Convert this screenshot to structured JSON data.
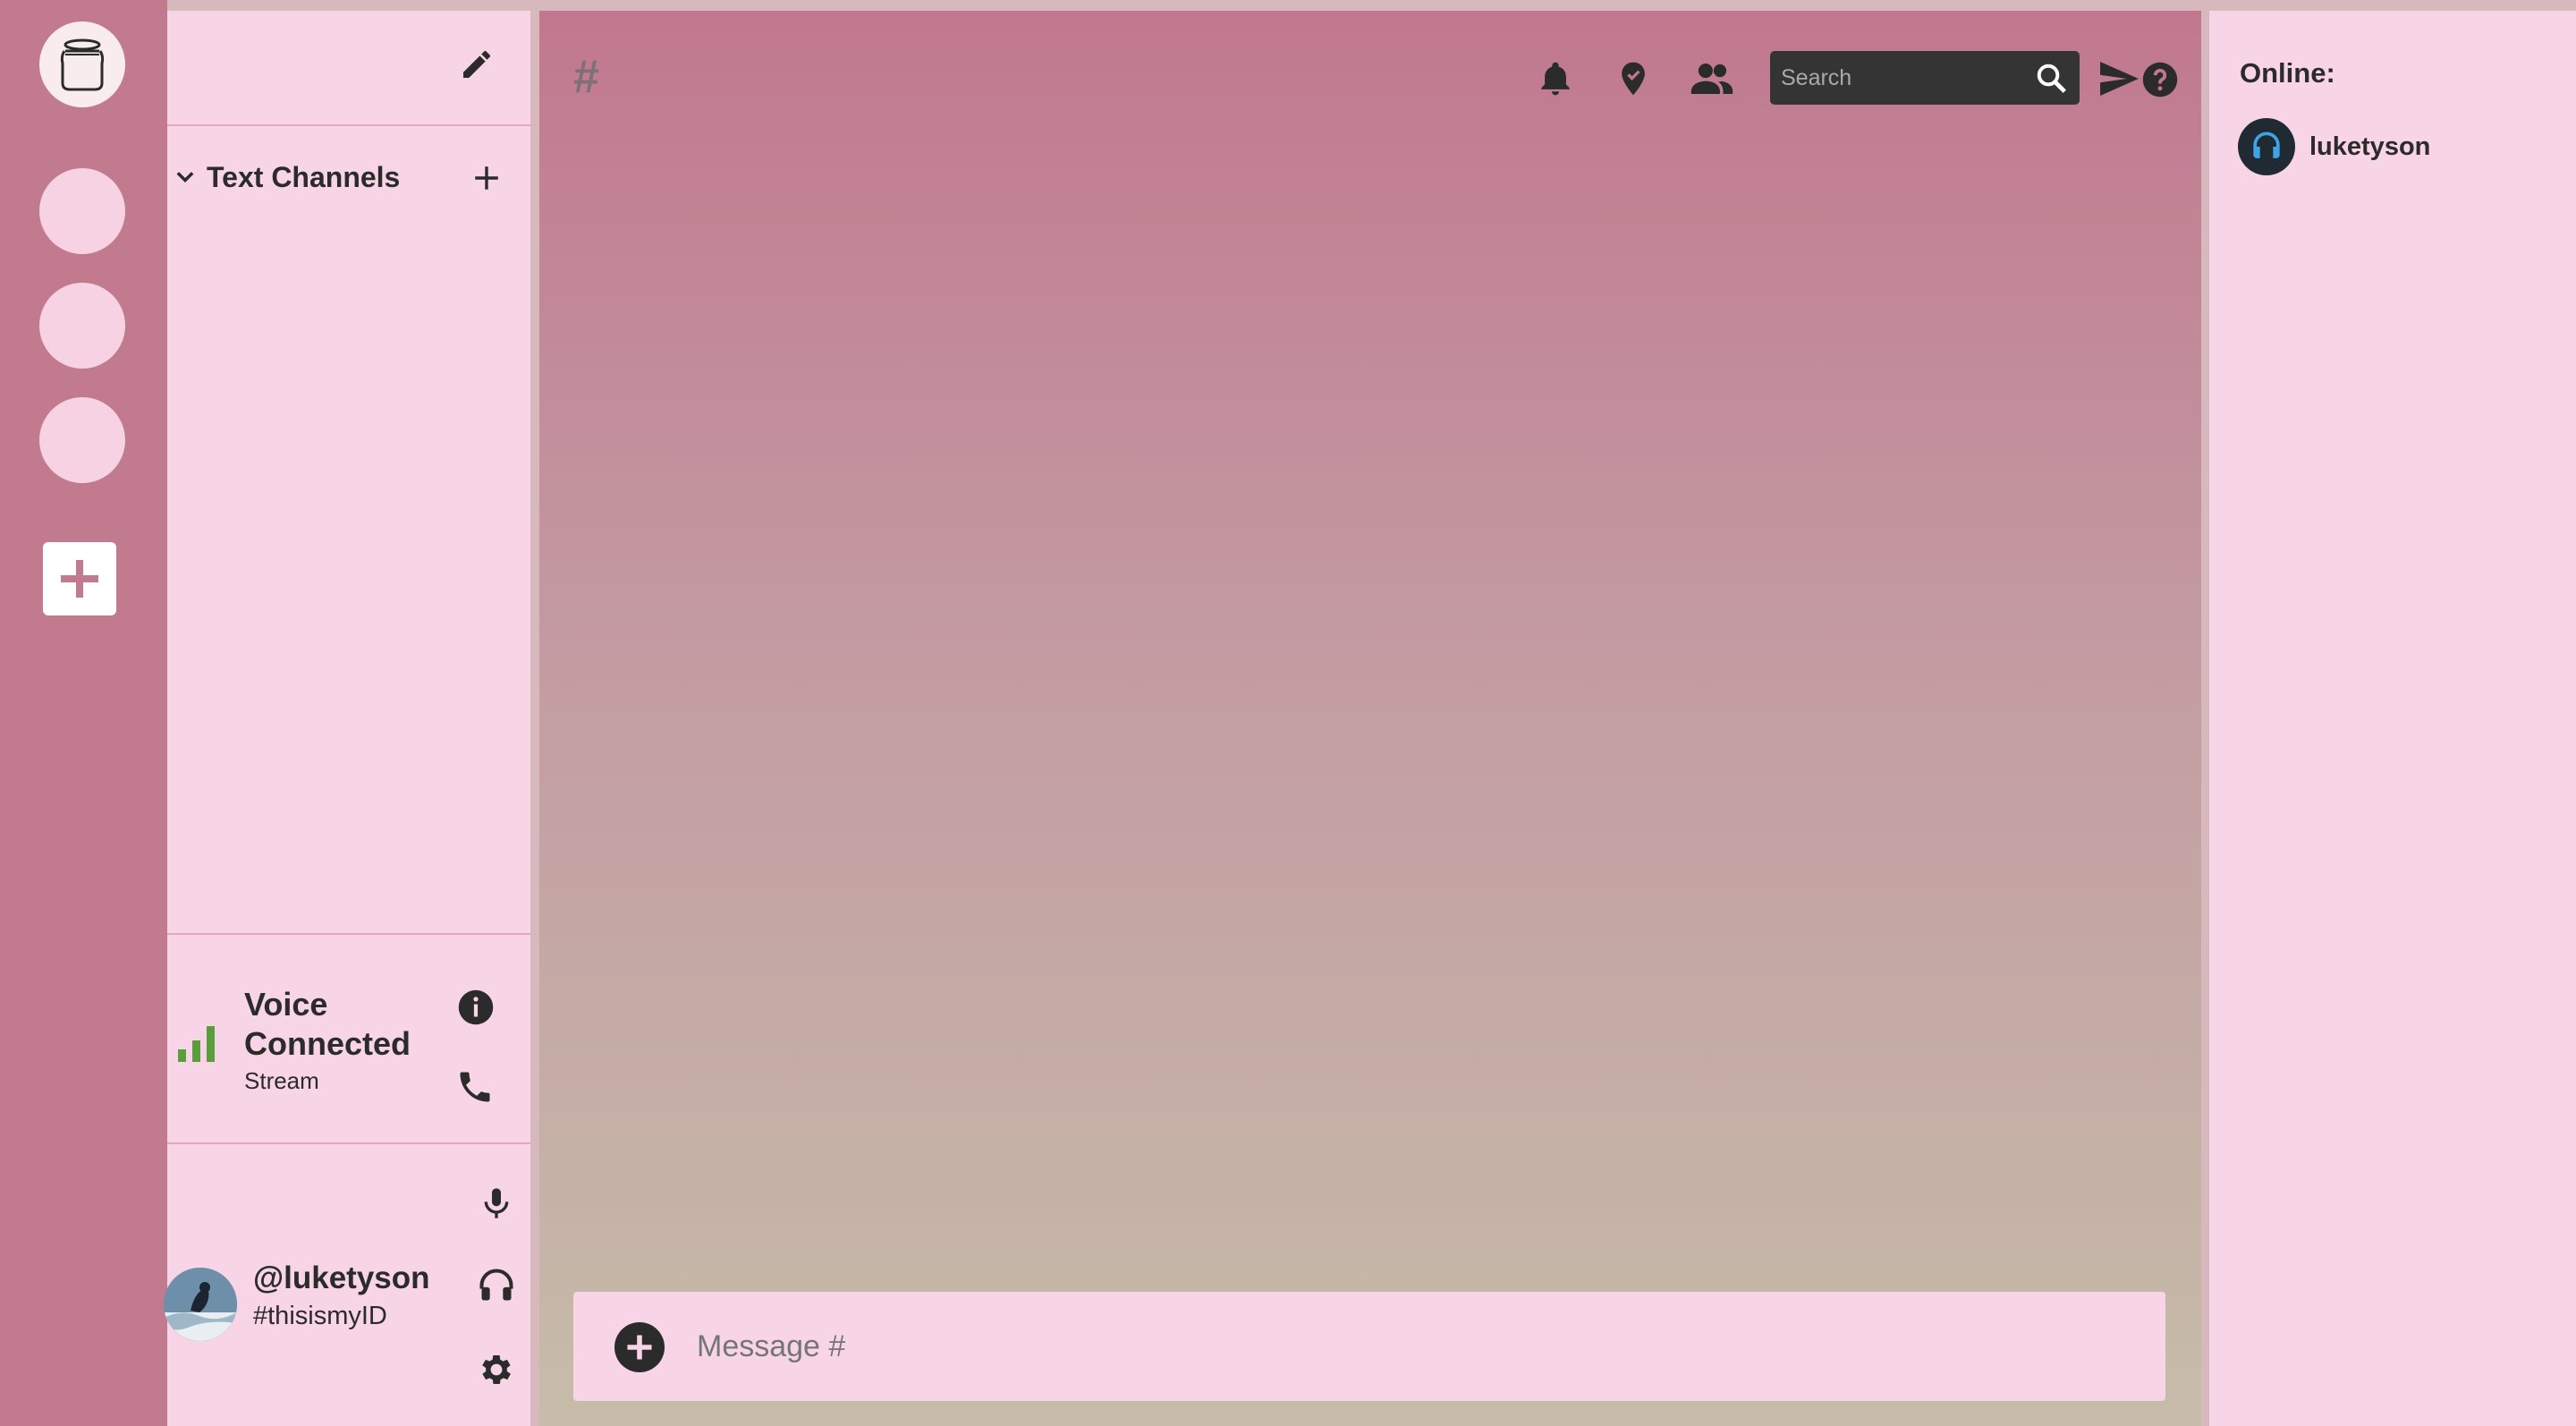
{
  "colors": {
    "rail": "#c27a8f",
    "panel": "#f7d4e6",
    "chat_gradient_top": "#c1788f",
    "chat_gradient_bottom": "#c6bca9",
    "search_bg": "#343434",
    "signal_green": "#5a9e3c"
  },
  "rail": {
    "logo_icon": "jar-icon",
    "servers": [
      "",
      "",
      ""
    ],
    "add_icon": "plus-icon"
  },
  "sidebar": {
    "edit_icon": "pencil-icon",
    "category": {
      "label": "Text Channels",
      "collapse_icon": "chevron-down-icon",
      "add_icon": "plus-icon"
    },
    "voice": {
      "title": "Voice Connected",
      "subtitle": "Stream",
      "signal_icon": "signal-bars-icon",
      "info_icon": "info-icon",
      "hangup_icon": "phone-icon"
    },
    "user": {
      "name": "@luketyson",
      "tag": "#thisismyID",
      "mic_icon": "microphone-icon",
      "headset_icon": "headphones-icon",
      "settings_icon": "gear-icon"
    }
  },
  "chat": {
    "channel_symbol": "#",
    "header_icons": [
      "bell-icon",
      "pin-icon",
      "members-icon",
      "send-icon",
      "help-icon"
    ],
    "search": {
      "placeholder": "Search",
      "value": ""
    },
    "composer": {
      "placeholder": "Message #",
      "value": "",
      "attach_icon": "plus-circle-icon"
    }
  },
  "members": {
    "title": "Online:",
    "list": [
      {
        "name": "luketyson",
        "avatar_icon": "user-avatar-icon"
      }
    ]
  }
}
